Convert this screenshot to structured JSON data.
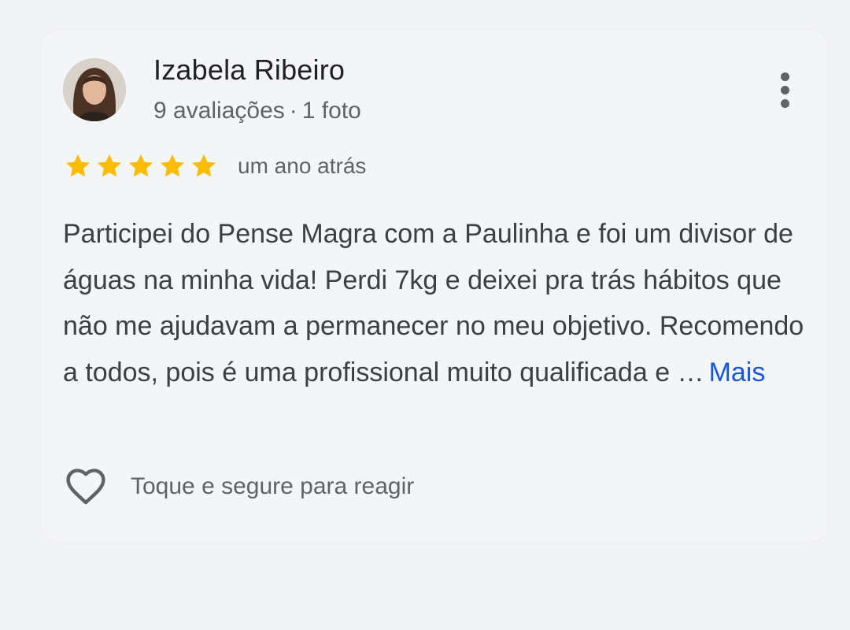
{
  "review": {
    "author": {
      "name": "Izabela Ribeiro",
      "reviews_count": "9 avaliações",
      "separator": "·",
      "photos_count": "1 foto",
      "avatar_icon": "profile-photo"
    },
    "menu_icon": "more-vert-icon",
    "rating": {
      "stars": 5,
      "max_stars": 5,
      "star_color": "#fbbc04",
      "time_ago": "um ano atrás"
    },
    "text": "Participei do Pense Magra com a Paulinha e foi um divisor de águas na minha vida! Perdi 7kg e deixei pra trás hábitos que não me ajudavam a permanecer no meu objetivo. Recomendo a todos, pois é uma profissional muito qualificada e …",
    "more_label": "Mais",
    "more_color": "#1a56d6",
    "reaction": {
      "icon": "heart-outline-icon",
      "hint": "Toque e segure para reagir"
    }
  }
}
